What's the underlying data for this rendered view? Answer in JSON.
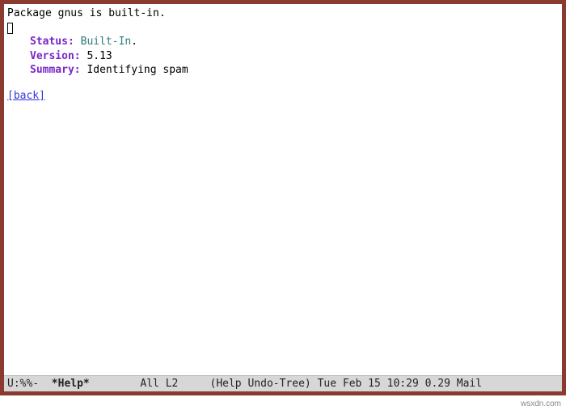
{
  "package": {
    "header": "Package gnus is built-in.",
    "fields": {
      "status_label": "Status:",
      "status_value": "Built-In",
      "status_suffix": ".",
      "version_label": "Version:",
      "version_value": "5.13",
      "summary_label": "Summary:",
      "summary_value": "Identifying spam"
    },
    "back_link": "[back]"
  },
  "modeline": {
    "coding": "U:%%-",
    "buffer_name": "*Help*",
    "position": "All",
    "line": "L2",
    "modes": "(Help Undo-Tree)",
    "datetime": "Tue Feb 15 10:29",
    "load": "0.29",
    "extra": "Mail"
  },
  "attribution": "wsxdn.com"
}
